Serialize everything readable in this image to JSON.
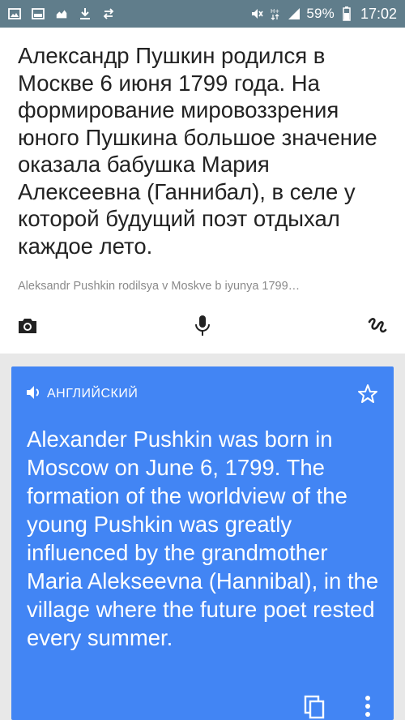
{
  "status_bar": {
    "icons_left": [
      "image-icon",
      "photo-icon",
      "cloud-icon",
      "download-icon",
      "sync-icon"
    ],
    "icons_right": [
      "mute-icon",
      "data-icon",
      "signal-icon"
    ],
    "battery": "59%",
    "time": "17:02"
  },
  "source": {
    "text": "Александр Пушкин родился в Москве 6 июня 1799 года. На формирование мировоззрения юного Пушкина большое значение оказала бабушка Мария Алексеевна (Ганнибал), в селе у которой будущий поэт отдыхал каждое лето.",
    "transliteration": "Aleksandr Pushkin rodilsya v Moskve b iyunya 1799…",
    "tools": [
      "camera-icon",
      "microphone-icon",
      "handwriting-icon"
    ]
  },
  "translation": {
    "language_label": "АНГЛИЙСКИЙ",
    "text": "Alexander Pushkin was born in Moscow on June 6, 1799. The formation of the worldview of the young Pushkin was greatly influenced by the grandmother Maria Alekseevna (Hannibal), in the village where the future poet rested every summer.",
    "tools": [
      "copy-icon",
      "more-icon"
    ]
  },
  "colors": {
    "status_bar": "#607d8b",
    "translation_card": "#4285f4",
    "source_text": "#222222",
    "transliteration": "#8a8a8a"
  }
}
